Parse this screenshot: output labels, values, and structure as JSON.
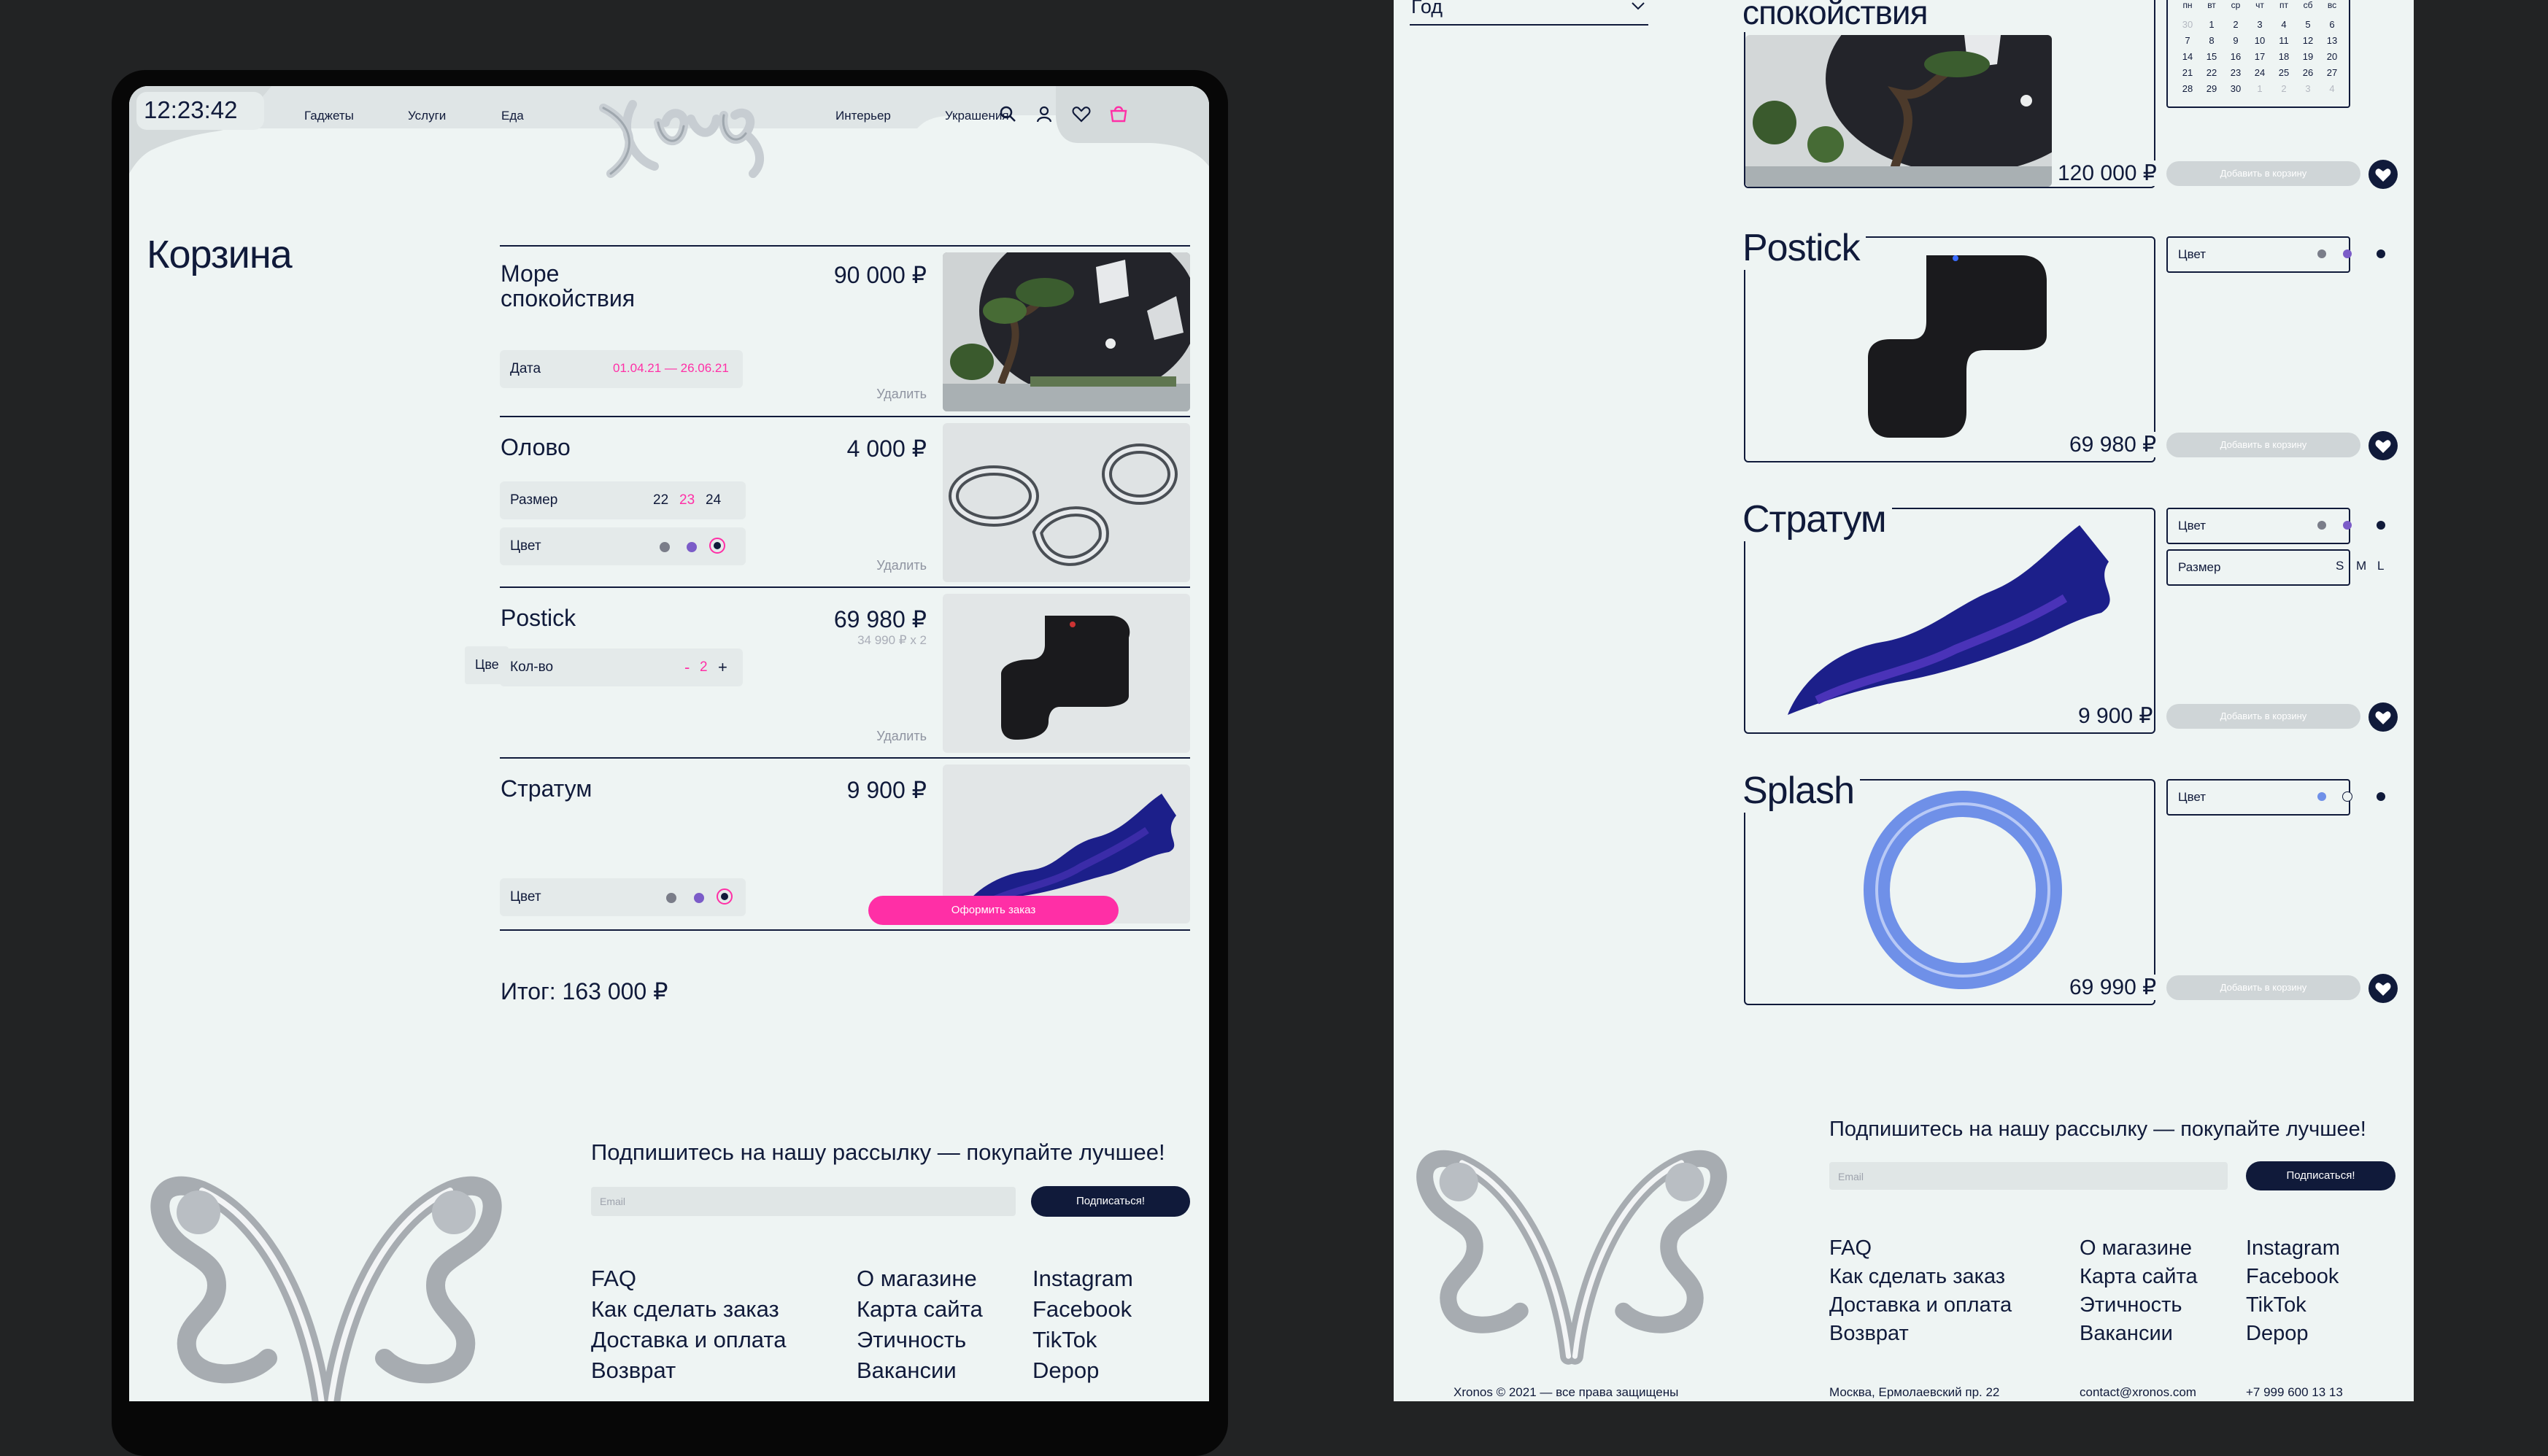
{
  "tablet": {
    "clock": "12:23:42",
    "nav_left": [
      "Гаджеты",
      "Услуги",
      "Еда"
    ],
    "nav_right": [
      "Интерьер",
      "Украшения"
    ],
    "icons": [
      "search-icon",
      "user-icon",
      "heart-icon",
      "cart-icon"
    ],
    "page_title": "Корзина",
    "cart": [
      {
        "name_lines": [
          "Море",
          "спокойствия"
        ],
        "price": "90 000 ₽",
        "options": [
          {
            "label": "Дата",
            "value": "01.04.21 — 26.06.21"
          }
        ],
        "delete": "Удалить"
      },
      {
        "name": "Олово",
        "price": "4 000 ₽",
        "size_label": "Размер",
        "sizes": [
          "22",
          "23",
          "24"
        ],
        "selected_size": "23",
        "color_label": "Цвет",
        "delete": "Удалить"
      },
      {
        "name": "Postick",
        "price": "69 980 ₽",
        "unit_price": "34 990 ₽ x 2",
        "tooltip_fragment": "Цве",
        "qty_label": "Кол-во",
        "qty_minus": "-",
        "qty": "2",
        "qty_plus": "+",
        "delete": "Удалить"
      },
      {
        "name": "Стратум",
        "price": "9 900 ₽",
        "color_label": "Цвет"
      }
    ],
    "checkout": "Оформить заказ",
    "total": "Итог: 163 000 ₽",
    "subscribe": {
      "heading": "Подпишитесь на нашу рассылку — покупайте лучшее!",
      "placeholder": "Email",
      "button": "Подписаться!"
    },
    "footer_cols": [
      [
        "FAQ",
        "Как сделать заказ",
        "Доставка и оплата",
        "Возврат"
      ],
      [
        "О магазине",
        "Карта сайта",
        "Этичность",
        "Вакансии"
      ],
      [
        "Instagram",
        "Facebook",
        "TikTok",
        "Depop"
      ]
    ]
  },
  "panel": {
    "filter_label": "Год",
    "calendar": {
      "weekdays": [
        "пн",
        "вт",
        "ср",
        "чт",
        "пт",
        "сб",
        "вс"
      ],
      "rows": [
        [
          "30",
          "1",
          "2",
          "3",
          "4",
          "5",
          "6"
        ],
        [
          "7",
          "8",
          "9",
          "10",
          "11",
          "12",
          "13"
        ],
        [
          "14",
          "15",
          "16",
          "17",
          "18",
          "19",
          "20"
        ],
        [
          "21",
          "22",
          "23",
          "24",
          "25",
          "26",
          "27"
        ],
        [
          "28",
          "29",
          "30",
          "1",
          "2",
          "3",
          "4"
        ]
      ]
    },
    "products": [
      {
        "title": "спокойствия",
        "price": "120 000 ₽",
        "add": "Добавить в корзину"
      },
      {
        "title": "Postick",
        "price": "69 980 ₽",
        "add": "Добавить в корзину",
        "color_label": "Цвет"
      },
      {
        "title": "Стратум",
        "price": "9 900 ₽",
        "add": "Добавить в корзину",
        "color_label": "Цвет",
        "size_label": "Размер",
        "sizes": [
          "S",
          "M",
          "L"
        ]
      },
      {
        "title": "Splash",
        "price": "69 990 ₽",
        "add": "Добавить в корзину",
        "color_label": "Цвет"
      }
    ],
    "subscribe": {
      "heading": "Подпишитесь на нашу рассылку — покупайте лучшее!",
      "placeholder": "Email",
      "button": "Подписаться!"
    },
    "footer_cols": [
      [
        "FAQ",
        "Как сделать заказ",
        "Доставка и оплата",
        "Возврат"
      ],
      [
        "О магазине",
        "Карта сайта",
        "Этичность",
        "Вакансии"
      ],
      [
        "Instagram",
        "Facebook",
        "TikTok",
        "Depop"
      ]
    ],
    "bottom": {
      "copyright": "Xronos © 2021 — все права защищены",
      "address": "Москва, Ермолаевский пр. 22",
      "email": "contact@xronos.com",
      "phone": "+7 999 600 13 13"
    }
  },
  "colors": {
    "accent": "#ff2fa6",
    "navy": "#101a3a",
    "bg": "#eef4f3"
  }
}
